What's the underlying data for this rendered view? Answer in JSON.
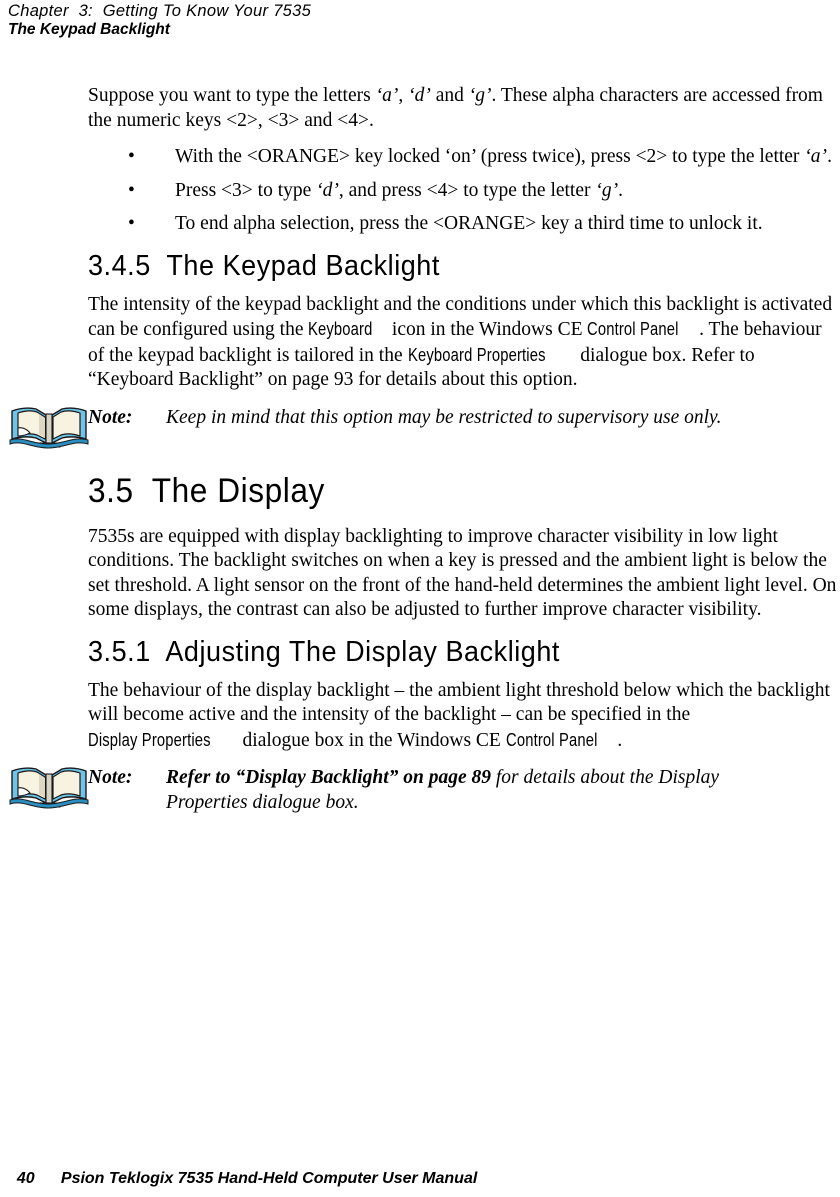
{
  "header": {
    "chapter": "Chapter  3:  Getting To Know Your 7535",
    "section_title": "The Keypad Backlight"
  },
  "content": {
    "intro_para": {
      "part1": "Suppose you want to type the letters ",
      "letter_a": "‘a’",
      "sep1": ", ",
      "letter_d": "‘d’",
      "sep2": " and ",
      "letter_g": "‘g’",
      "part2": ". These alpha characters are accessed from the numeric keys <2>, <3> and <4>."
    },
    "bullets": [
      {
        "marker": "•",
        "text_before": "With the <ORANGE> key locked ‘on’ (press twice), press <2> to type the letter ",
        "emphasis": "‘a’",
        "text_after": "."
      },
      {
        "marker": "•",
        "text_before": "Press <3> to type ",
        "emphasis": "‘d’",
        "text_mid": ", and press <4> to type the letter ",
        "emphasis2": "‘g’",
        "text_after": "."
      },
      {
        "marker": "•",
        "text_before": "To end alpha selection, press the <ORANGE> key a third time to unlock it.",
        "emphasis": "",
        "text_after": ""
      }
    ],
    "heading_345": "3.4.5  The Keypad Backlight",
    "keypad_backlight_para": {
      "seg1": "The intensity of the keypad backlight and the conditions under which this backlight is activated can be configured using the ",
      "ui1": "Keyboard",
      "seg2": " icon in the Windows CE ",
      "ui2": "Control Panel",
      "seg3": ". The behaviour of the keypad backlight is tailored in the ",
      "ui3": "Keyboard Properties",
      "seg4": " dialogue box. Refer to “Keyboard Backlight” on page 93 for details about this option."
    },
    "note1": {
      "label": "Note:",
      "text": "Keep in mind that this option may be restricted to supervisory use only.",
      "icon": "open-book-icon"
    },
    "heading_35": "3.5  The Display",
    "display_para": "7535s are equipped with display backlighting to improve character visibility in low light conditions. The backlight switches on when a key is pressed and the ambient light is below the set threshold. A light sensor on the front of the hand-held determines the ambient light level. On some displays, the contrast can also be adjusted to further improve character visibility.",
    "heading_351": "3.5.1  Adjusting The Display Backlight",
    "display_backlight_para": {
      "seg1": "The behaviour of the display backlight – the ambient light threshold below which the backlight will become active and the intensity of the backlight – can be specified in the ",
      "ui1": "Display Properties",
      "seg2": " dialogue box in the Windows CE ",
      "ui2": "Control Panel",
      "seg3": "."
    },
    "note2": {
      "label": "Note:",
      "bold_text": "Refer to “Display Backlight” on page 89",
      "text": " for details about the Display",
      "line2": "Properties dialogue box.",
      "icon": "open-book-icon"
    }
  },
  "footer": {
    "page_number": "40",
    "manual_title": "Psion Teklogix 7535 Hand-Held Computer User Manual"
  },
  "colors": {
    "text": "#000000",
    "book_cover": "#6fc4e8",
    "book_cover_dark": "#2a8fc0",
    "book_page": "#f7f3e0",
    "book_page_shadow": "#ddd8c2",
    "book_spine": "#4a3a22",
    "page_background": "#ffffff"
  }
}
